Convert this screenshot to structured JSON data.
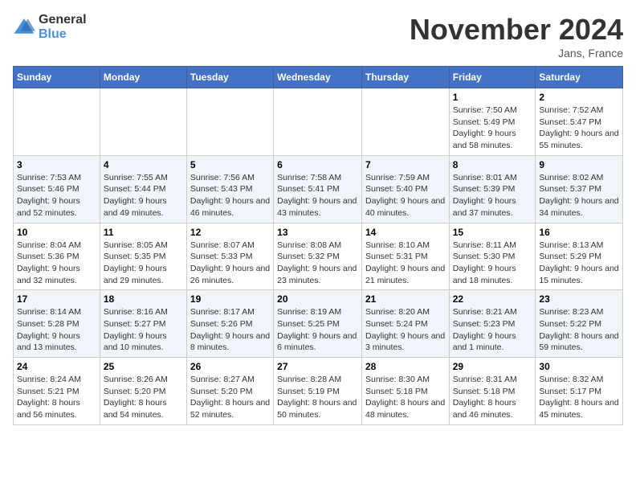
{
  "logo": {
    "line1": "General",
    "line2": "Blue"
  },
  "title": "November 2024",
  "location": "Jans, France",
  "days_of_week": [
    "Sunday",
    "Monday",
    "Tuesday",
    "Wednesday",
    "Thursday",
    "Friday",
    "Saturday"
  ],
  "weeks": [
    [
      {
        "day": "",
        "info": ""
      },
      {
        "day": "",
        "info": ""
      },
      {
        "day": "",
        "info": ""
      },
      {
        "day": "",
        "info": ""
      },
      {
        "day": "",
        "info": ""
      },
      {
        "day": "1",
        "info": "Sunrise: 7:50 AM\nSunset: 5:49 PM\nDaylight: 9 hours and 58 minutes."
      },
      {
        "day": "2",
        "info": "Sunrise: 7:52 AM\nSunset: 5:47 PM\nDaylight: 9 hours and 55 minutes."
      }
    ],
    [
      {
        "day": "3",
        "info": "Sunrise: 7:53 AM\nSunset: 5:46 PM\nDaylight: 9 hours and 52 minutes."
      },
      {
        "day": "4",
        "info": "Sunrise: 7:55 AM\nSunset: 5:44 PM\nDaylight: 9 hours and 49 minutes."
      },
      {
        "day": "5",
        "info": "Sunrise: 7:56 AM\nSunset: 5:43 PM\nDaylight: 9 hours and 46 minutes."
      },
      {
        "day": "6",
        "info": "Sunrise: 7:58 AM\nSunset: 5:41 PM\nDaylight: 9 hours and 43 minutes."
      },
      {
        "day": "7",
        "info": "Sunrise: 7:59 AM\nSunset: 5:40 PM\nDaylight: 9 hours and 40 minutes."
      },
      {
        "day": "8",
        "info": "Sunrise: 8:01 AM\nSunset: 5:39 PM\nDaylight: 9 hours and 37 minutes."
      },
      {
        "day": "9",
        "info": "Sunrise: 8:02 AM\nSunset: 5:37 PM\nDaylight: 9 hours and 34 minutes."
      }
    ],
    [
      {
        "day": "10",
        "info": "Sunrise: 8:04 AM\nSunset: 5:36 PM\nDaylight: 9 hours and 32 minutes."
      },
      {
        "day": "11",
        "info": "Sunrise: 8:05 AM\nSunset: 5:35 PM\nDaylight: 9 hours and 29 minutes."
      },
      {
        "day": "12",
        "info": "Sunrise: 8:07 AM\nSunset: 5:33 PM\nDaylight: 9 hours and 26 minutes."
      },
      {
        "day": "13",
        "info": "Sunrise: 8:08 AM\nSunset: 5:32 PM\nDaylight: 9 hours and 23 minutes."
      },
      {
        "day": "14",
        "info": "Sunrise: 8:10 AM\nSunset: 5:31 PM\nDaylight: 9 hours and 21 minutes."
      },
      {
        "day": "15",
        "info": "Sunrise: 8:11 AM\nSunset: 5:30 PM\nDaylight: 9 hours and 18 minutes."
      },
      {
        "day": "16",
        "info": "Sunrise: 8:13 AM\nSunset: 5:29 PM\nDaylight: 9 hours and 15 minutes."
      }
    ],
    [
      {
        "day": "17",
        "info": "Sunrise: 8:14 AM\nSunset: 5:28 PM\nDaylight: 9 hours and 13 minutes."
      },
      {
        "day": "18",
        "info": "Sunrise: 8:16 AM\nSunset: 5:27 PM\nDaylight: 9 hours and 10 minutes."
      },
      {
        "day": "19",
        "info": "Sunrise: 8:17 AM\nSunset: 5:26 PM\nDaylight: 9 hours and 8 minutes."
      },
      {
        "day": "20",
        "info": "Sunrise: 8:19 AM\nSunset: 5:25 PM\nDaylight: 9 hours and 6 minutes."
      },
      {
        "day": "21",
        "info": "Sunrise: 8:20 AM\nSunset: 5:24 PM\nDaylight: 9 hours and 3 minutes."
      },
      {
        "day": "22",
        "info": "Sunrise: 8:21 AM\nSunset: 5:23 PM\nDaylight: 9 hours and 1 minute."
      },
      {
        "day": "23",
        "info": "Sunrise: 8:23 AM\nSunset: 5:22 PM\nDaylight: 8 hours and 59 minutes."
      }
    ],
    [
      {
        "day": "24",
        "info": "Sunrise: 8:24 AM\nSunset: 5:21 PM\nDaylight: 8 hours and 56 minutes."
      },
      {
        "day": "25",
        "info": "Sunrise: 8:26 AM\nSunset: 5:20 PM\nDaylight: 8 hours and 54 minutes."
      },
      {
        "day": "26",
        "info": "Sunrise: 8:27 AM\nSunset: 5:20 PM\nDaylight: 8 hours and 52 minutes."
      },
      {
        "day": "27",
        "info": "Sunrise: 8:28 AM\nSunset: 5:19 PM\nDaylight: 8 hours and 50 minutes."
      },
      {
        "day": "28",
        "info": "Sunrise: 8:30 AM\nSunset: 5:18 PM\nDaylight: 8 hours and 48 minutes."
      },
      {
        "day": "29",
        "info": "Sunrise: 8:31 AM\nSunset: 5:18 PM\nDaylight: 8 hours and 46 minutes."
      },
      {
        "day": "30",
        "info": "Sunrise: 8:32 AM\nSunset: 5:17 PM\nDaylight: 8 hours and 45 minutes."
      }
    ]
  ]
}
